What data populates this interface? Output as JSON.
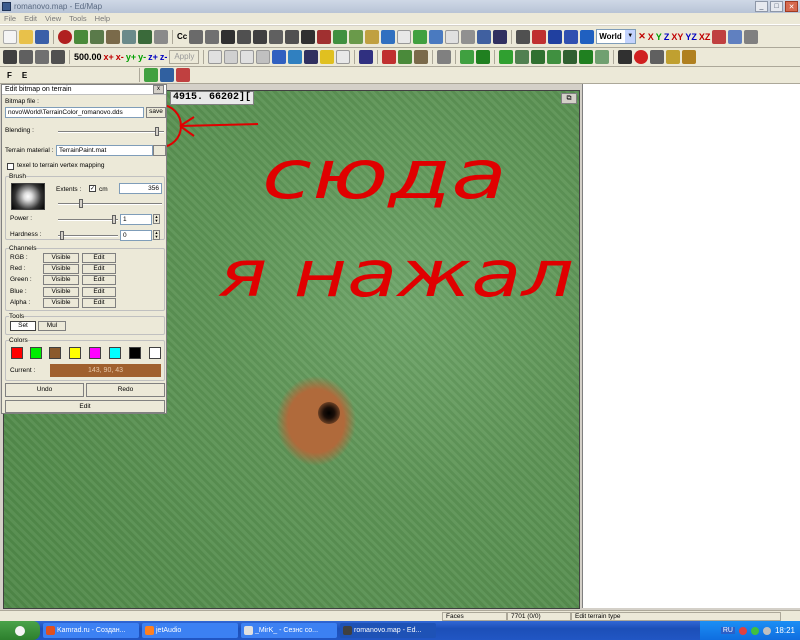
{
  "window": {
    "title": "romanovo.map - Ed/Map",
    "buttons": {
      "minimize": "_",
      "maximize": "□",
      "close": "✕"
    }
  },
  "menu": [
    "File",
    "Edit",
    "View",
    "Tools",
    "Help"
  ],
  "toolbar": {
    "step_value": "500.00",
    "axis_labels": [
      "x+",
      "x-",
      "y+",
      "y-",
      "z+",
      "z-"
    ],
    "apply_label": "Apply",
    "cc_label": "Cc",
    "coord_system": "World",
    "axes_buttons": [
      "X",
      "Y",
      "Z",
      "XY",
      "YZ",
      "XZ"
    ],
    "fe_tabs": [
      "F",
      "E"
    ]
  },
  "viewport": {
    "coords": "4915. 66202][",
    "max_button": "⧉",
    "brush_color": "#b06a3b"
  },
  "annotation": {
    "line1": "сюда",
    "line2": "я нажал",
    "color": "#e00000"
  },
  "dialog": {
    "title": "Edit bitmap on terrain",
    "close": "x",
    "bitmap_file_label": "Bitmap file :",
    "bitmap_file_value": "novo\\World\\TerrainColor_romanovo.dds",
    "save_label": "save",
    "blending_label": "Blending :",
    "blending": 0.95,
    "terrain_material_label": "Terrain material :",
    "terrain_material_value": "TerrainPaint.mat",
    "texel_label": "texel to terrain vertex mapping",
    "brush_group": "Brush",
    "extents_label": "Extents :",
    "cm_label": "cm",
    "extents_value": "356",
    "power_label": "Power :",
    "power_value": "1",
    "hardness_label": "Hardness :",
    "hardness_value": "0",
    "channels_group": "Channels",
    "channels": [
      {
        "label": "RGB :",
        "visible": "Visible",
        "edit": "Edit"
      },
      {
        "label": "Red :",
        "visible": "Visible",
        "edit": "Edit"
      },
      {
        "label": "Green :",
        "visible": "Visible",
        "edit": "Edit"
      },
      {
        "label": "Blue :",
        "visible": "Visible",
        "edit": "Edit"
      },
      {
        "label": "Alpha :",
        "visible": "Visible",
        "edit": "Edit"
      }
    ],
    "tools_group": "Tools",
    "tool_set": "Set",
    "tool_mul": "Mul",
    "colors_group": "Colors",
    "swatches": [
      "#ff0000",
      "#00ee00",
      "#8b5a2b",
      "#ffff00",
      "#ff00ff",
      "#00ffff",
      "#000000",
      "#ffffff"
    ],
    "current_label": "Current :",
    "current_value": "143, 90, 43",
    "current_color": "#a0602e",
    "undo_label": "Undo",
    "redo_label": "Redo",
    "edit_label": "Edit"
  },
  "status": {
    "faces_label": "Faces",
    "faces_value": "7701 (0/0)",
    "mode": "Edit terrain type"
  },
  "taskbar": {
    "tasks": [
      "Kamrad.ru - Создан...",
      "jetAudio",
      "_MirK_ - Сезнс со...",
      "romanovo.map - Ed..."
    ],
    "lang": "RU",
    "clock": "18:21"
  }
}
